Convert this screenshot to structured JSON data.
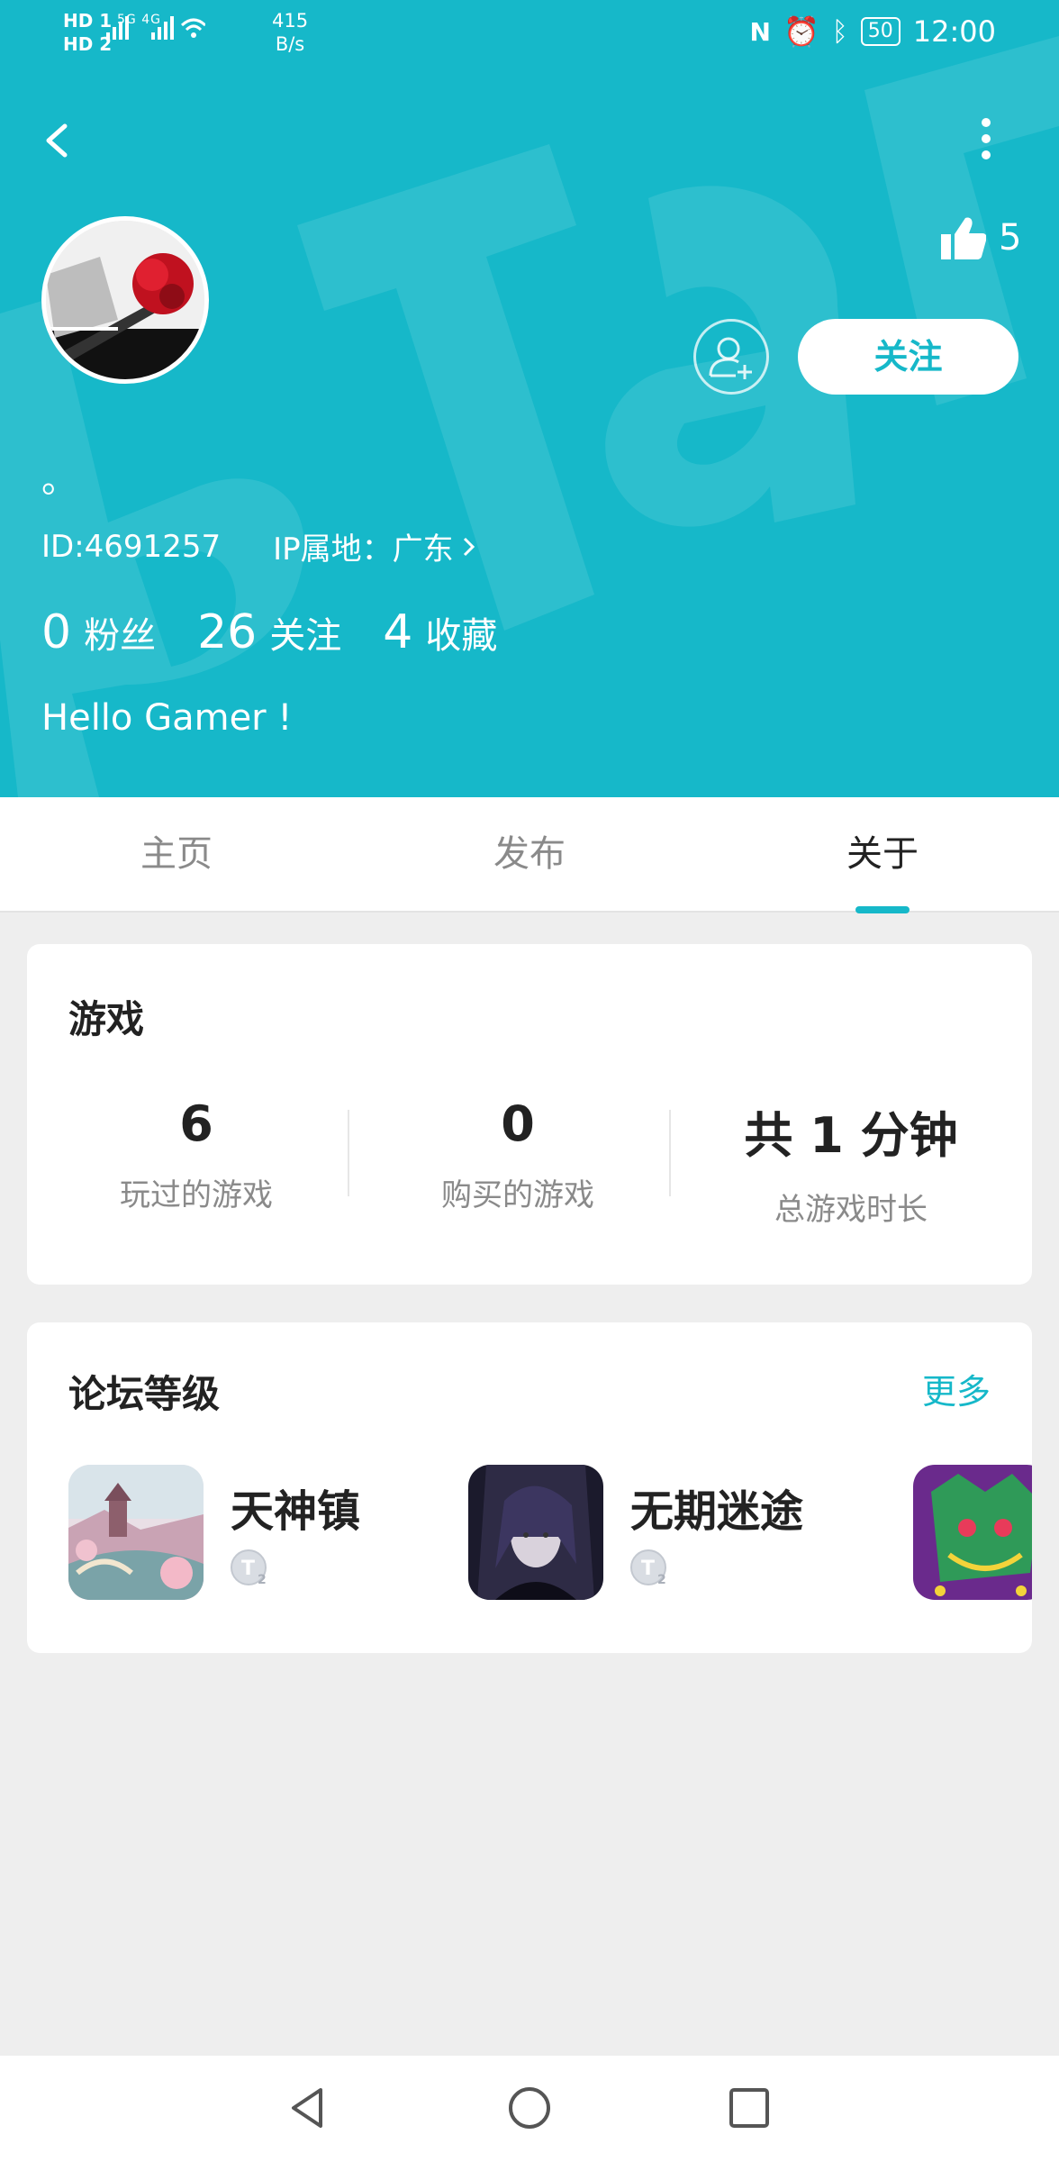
{
  "status_bar": {
    "sim1": "HD 1",
    "sim2": "HD 2",
    "signal": "5G  4G",
    "speed_value": "415",
    "speed_unit": "B/s",
    "battery": "50",
    "time": "12:00"
  },
  "profile": {
    "likes": "5",
    "follow_label": "关注",
    "nickname": "。",
    "id_text": "ID:4691257",
    "ip_text": "IP属地：广东",
    "bio": "Hello Gamer !"
  },
  "stats": [
    {
      "value": "0",
      "label": "粉丝"
    },
    {
      "value": "26",
      "label": "关注"
    },
    {
      "value": "4",
      "label": "收藏"
    }
  ],
  "tabs": [
    {
      "label": "主页"
    },
    {
      "label": "发布"
    },
    {
      "label": "关于"
    }
  ],
  "games_card": {
    "title": "游戏",
    "stats": [
      {
        "value": "6",
        "label": "玩过的游戏"
      },
      {
        "value": "0",
        "label": "购买的游戏"
      },
      {
        "value": "共 1 分钟",
        "label": "总游戏时长"
      }
    ]
  },
  "forum_card": {
    "title": "论坛等级",
    "more_label": "更多",
    "items": [
      {
        "name": "天神镇"
      },
      {
        "name": "无期迷途"
      }
    ]
  },
  "colors": {
    "accent": "#16b8c9",
    "background": "#eeeeee"
  }
}
